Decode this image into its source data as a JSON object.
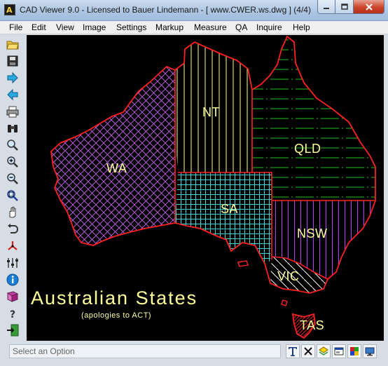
{
  "window": {
    "title": "CAD Viewer 9.0 - Licensed to Bauer Lindemann  -  [ www.CWER.ws.dwg ] (4/4)",
    "minimize_icon": "minimize-icon",
    "maximize_icon": "maximize-icon",
    "close_icon": "close-icon"
  },
  "menu": {
    "items": [
      "File",
      "Edit",
      "View",
      "Image",
      "Settings",
      "Markup",
      "Measure",
      "QA",
      "Inquire",
      "Help"
    ]
  },
  "toolbar": {
    "tools": [
      "open-folder-icon",
      "save-disk-icon",
      "next-arrow-icon",
      "previous-arrow-icon",
      "print-icon",
      "binoculars-icon",
      "zoom-magnifier-icon",
      "zoom-in-icon",
      "zoom-out-icon",
      "zoom-extents-icon",
      "pan-hand-icon",
      "undo-arrow-icon",
      "axis-icon",
      "layers-toggle-icon",
      "info-icon",
      "book-icon",
      "help-question-icon",
      "exit-icon"
    ]
  },
  "drawing": {
    "states": {
      "wa": "WA",
      "nt": "NT",
      "qld": "QLD",
      "sa": "SA",
      "nsw": "NSW",
      "vic": "VIC",
      "tas": "TAS"
    },
    "title": "Australian States",
    "subtitle": "(apologies to ACT)",
    "colors": {
      "outline": "#ff2020",
      "wa_hatch": "#b45cd8",
      "nt_hatch": "#ffff9c",
      "qld_hatch": "#20c020",
      "sa_hatch": "#40d8d8",
      "nsw_hatch": "#b040ff",
      "vic_hatch": "#ffffff",
      "tas_hatch": "#ff2020",
      "text": "#ffff9c"
    }
  },
  "status": {
    "prompt": "Select an Option",
    "buttons": [
      "text-tool-icon",
      "close-x-icon",
      "layer-icon",
      "window-icon",
      "colors-icon",
      "monitor-icon"
    ]
  }
}
